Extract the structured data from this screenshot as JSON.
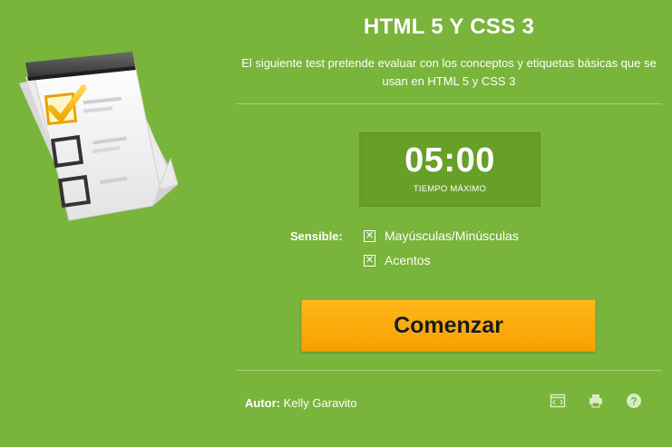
{
  "header": {
    "title": "HTML 5 Y CSS 3",
    "description": "El siguiente test pretende evaluar con los conceptos y etiquetas básicas que se usan en HTML 5 y CSS 3"
  },
  "timer": {
    "time": "05:00",
    "caption": "TIEMPO MÁXIMO"
  },
  "sensitivity": {
    "label": "Sensible:",
    "options": [
      {
        "label": "Mayúsculas/Minúsculas",
        "checked": true
      },
      {
        "label": "Acentos",
        "checked": true
      }
    ]
  },
  "start_button": {
    "label": "Comenzar"
  },
  "footer": {
    "author_label": "Autor:",
    "author_name": "Kelly Garavito",
    "icons": [
      "embed-icon",
      "print-icon",
      "help-icon"
    ]
  },
  "colors": {
    "background": "#79b43b",
    "timer_background": "#66a027",
    "button": "#ffad0d"
  }
}
